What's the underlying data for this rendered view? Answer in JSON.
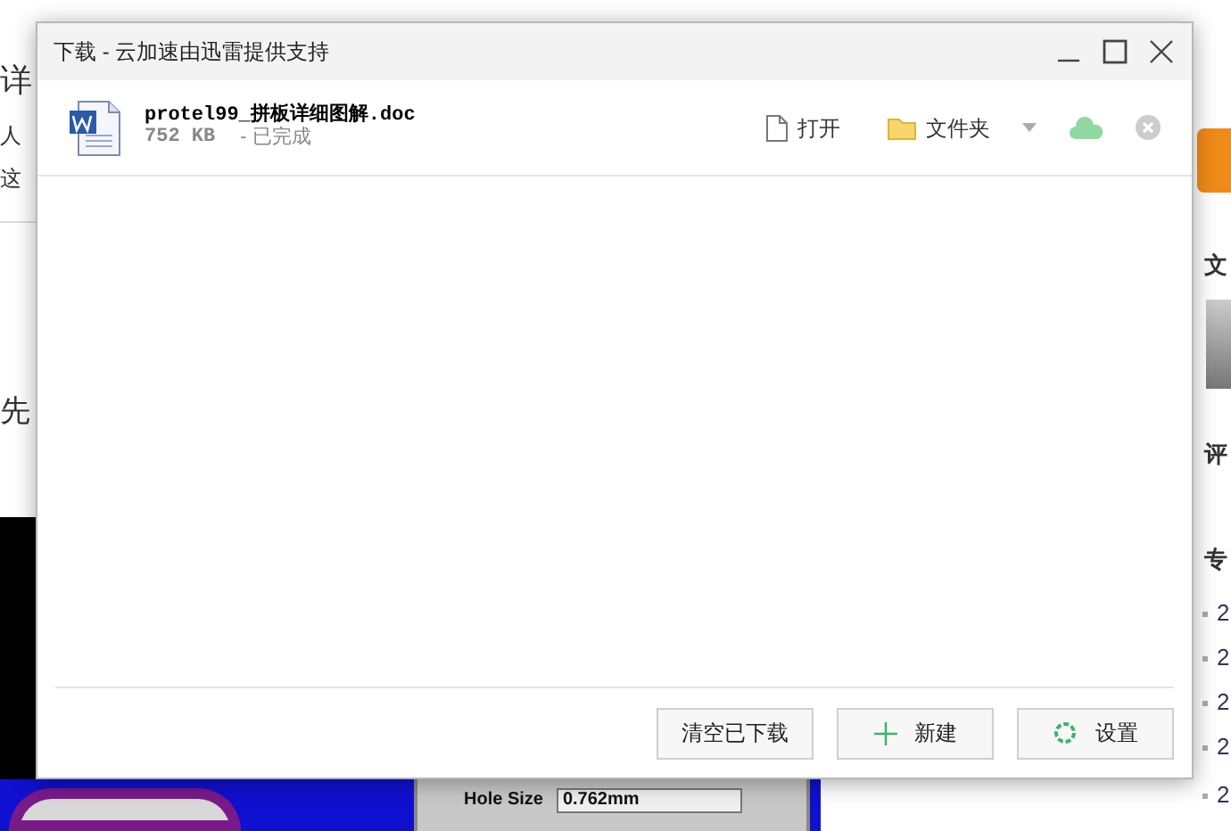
{
  "background_page": {
    "left_texts": [
      "详",
      "人",
      "这",
      "先"
    ],
    "right_texts": [
      "文",
      "评",
      "专"
    ],
    "right_list": [
      "2",
      "2",
      "2",
      "2",
      "2"
    ],
    "pcb_panel": {
      "label": "Hole Size",
      "value": "0.762mm"
    }
  },
  "window": {
    "title": "下载 - 云加速由迅雷提供支持"
  },
  "downloads": [
    {
      "name": "protel99_拼板详细图解.doc",
      "size": "752 KB",
      "status": "- 已完成"
    }
  ],
  "actions": [
    "打开",
    "文件夹"
  ],
  "buttons": [
    {
      "kind": "plain",
      "label": "清空已下载"
    },
    {
      "kind": "new",
      "label": "新建"
    },
    {
      "kind": "settings",
      "label": "设置"
    }
  ]
}
